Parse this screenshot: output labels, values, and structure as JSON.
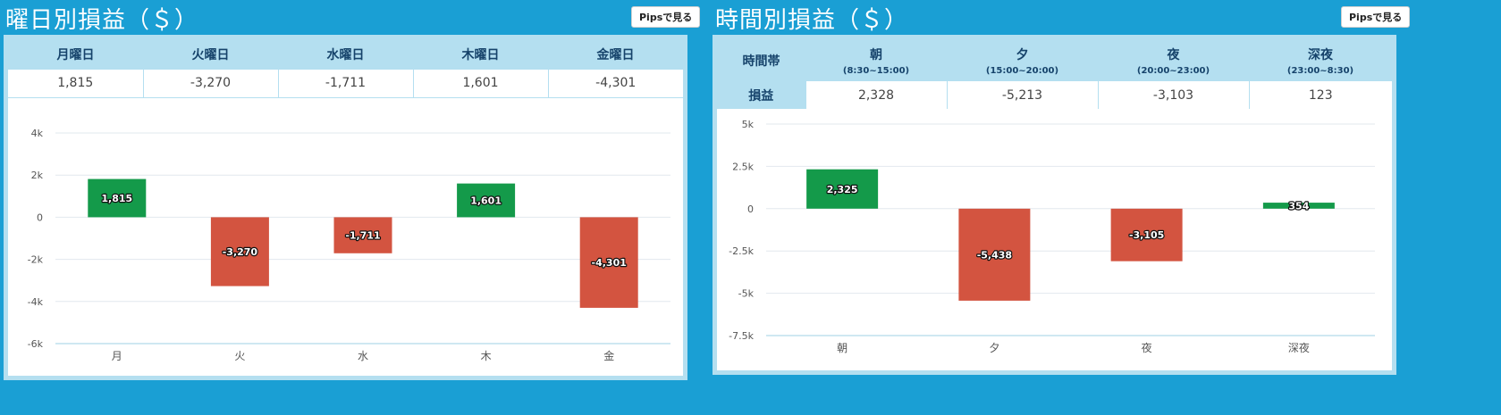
{
  "left": {
    "title": "曜日別損益（＄）",
    "pips_label": "Pipsで見る",
    "headers": [
      "月曜日",
      "火曜日",
      "水曜日",
      "木曜日",
      "金曜日"
    ],
    "values": [
      "1,815",
      "-3,270",
      "-1,711",
      "1,601",
      "-4,301"
    ]
  },
  "right": {
    "title": "時間別損益（＄）",
    "pips_label": "Pipsで見る",
    "row_header_1": "時間帯",
    "row_header_2": "損益",
    "headers": [
      {
        "label": "朝",
        "sub": "(8:30~15:00)"
      },
      {
        "label": "夕",
        "sub": "(15:00~20:00)"
      },
      {
        "label": "夜",
        "sub": "(20:00~23:00)"
      },
      {
        "label": "深夜",
        "sub": "(23:00~8:30)"
      }
    ],
    "values": [
      "2,328",
      "-5,213",
      "-3,103",
      "123"
    ]
  },
  "colors": {
    "positive": "#149a4a",
    "negative": "#d35440",
    "background": "#1a9fd4",
    "header": "#b4dff0"
  },
  "chart_data": [
    {
      "type": "bar",
      "categories": [
        "月",
        "火",
        "水",
        "木",
        "金"
      ],
      "values": [
        1815,
        -3270,
        -1711,
        1601,
        -4301
      ],
      "data_labels": [
        "1,815",
        "-3,270",
        "-1,711",
        "1,601",
        "-4,301"
      ],
      "ylim": [
        -6000,
        4000
      ],
      "yticks": [
        4000,
        2000,
        0,
        -2000,
        -4000,
        -6000
      ],
      "ytick_labels": [
        "4k",
        "2k",
        "0",
        "-2k",
        "-4k",
        "-6k"
      ],
      "grid": true
    },
    {
      "type": "bar",
      "categories": [
        "朝",
        "夕",
        "夜",
        "深夜"
      ],
      "values": [
        2325,
        -5438,
        -3105,
        354
      ],
      "data_labels": [
        "2,325",
        "-5,438",
        "-3,105",
        "354"
      ],
      "ylim": [
        -7500,
        5000
      ],
      "yticks": [
        5000,
        2500,
        0,
        -2500,
        -5000,
        -7500
      ],
      "ytick_labels": [
        "5k",
        "2.5k",
        "0",
        "-2.5k",
        "-5k",
        "-7.5k"
      ],
      "grid": true
    }
  ]
}
